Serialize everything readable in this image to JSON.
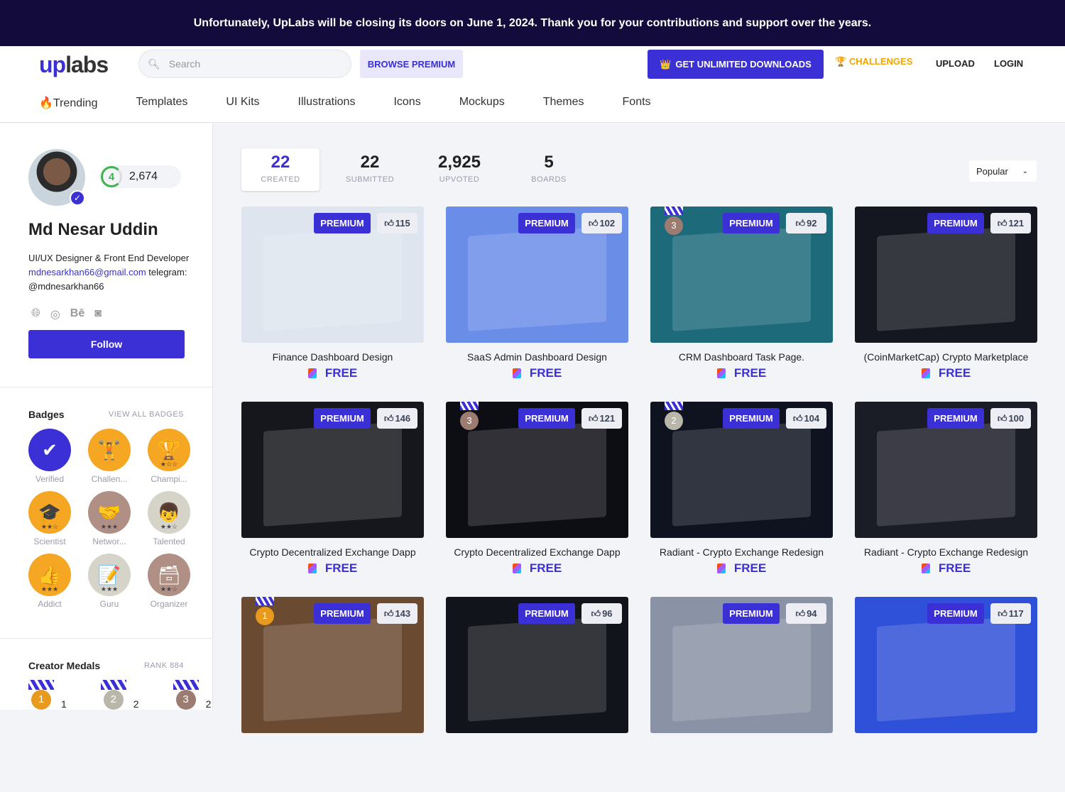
{
  "banner": "Unfortunately, UpLabs will be closing its doors on June 1, 2024. Thank you for your contributions and support over the years.",
  "header": {
    "logo_up": "up",
    "logo_labs": "labs",
    "search_placeholder": "Search",
    "browse_premium": "BROWSE PREMIUM",
    "get_unlimited": "GET UNLIMITED DOWNLOADS",
    "challenges": "CHALLENGES",
    "upload": "UPLOAD",
    "login": "LOGIN"
  },
  "nav": [
    "🔥Trending",
    "Templates",
    "UI Kits",
    "Illustrations",
    "Icons",
    "Mockups",
    "Themes",
    "Fonts"
  ],
  "profile": {
    "level": "4",
    "points": "2,674",
    "name": "Md Nesar Uddin",
    "role": "UI/UX Designer & Front End Developer",
    "email": "mdnesarkhan66@gmail.com",
    "telegram": " telegram: @mdnesarkhan66",
    "follow": "Follow"
  },
  "badges": {
    "title": "Badges",
    "view_all": "VIEW ALL BADGES",
    "items": [
      {
        "label": "Verified",
        "icon": "✔",
        "color": "#3b2fd6",
        "stars": ""
      },
      {
        "label": "Challen...",
        "icon": "🏋",
        "color": "#f5a623",
        "stars": ""
      },
      {
        "label": "Champi...",
        "icon": "🏆",
        "color": "#f5a623",
        "stars": "★☆☆"
      },
      {
        "label": "Scientist",
        "icon": "🎓",
        "color": "#f5a623",
        "stars": "★★☆"
      },
      {
        "label": "Networ...",
        "icon": "🤝",
        "color": "#b08f84",
        "stars": "★★★"
      },
      {
        "label": "Talented",
        "icon": "👦",
        "color": "#d6d3c8",
        "stars": "★★☆"
      },
      {
        "label": "Addict",
        "icon": "👍",
        "color": "#f5a623",
        "stars": "★★★"
      },
      {
        "label": "Guru",
        "icon": "📝",
        "color": "#d6d3c8",
        "stars": "★★★"
      },
      {
        "label": "Organizer",
        "icon": "🗃",
        "color": "#b08f84",
        "stars": "★★☆"
      }
    ]
  },
  "medals": {
    "title": "Creator Medals",
    "rank": "RANK 884",
    "items": [
      {
        "place": "1",
        "count": "1",
        "color": "#e89a1f"
      },
      {
        "place": "2",
        "count": "2",
        "color": "#b9b6aa"
      },
      {
        "place": "3",
        "count": "2",
        "color": "#9c7b70"
      }
    ]
  },
  "stats": [
    {
      "value": "22",
      "label": "CREATED"
    },
    {
      "value": "22",
      "label": "SUBMITTED"
    },
    {
      "value": "2,925",
      "label": "UPVOTED"
    },
    {
      "value": "5",
      "label": "BOARDS"
    }
  ],
  "sort": "Popular",
  "cards": [
    {
      "title": "Finance Dashboard Design",
      "likes": "115",
      "price": "FREE",
      "badge": "PREMIUM",
      "bg": "#dfe5ef",
      "medal": ""
    },
    {
      "title": "SaaS Admin Dashboard Design",
      "likes": "102",
      "price": "FREE",
      "badge": "PREMIUM",
      "bg": "#6a8de8",
      "medal": ""
    },
    {
      "title": "CRM Dashboard Task Page.",
      "likes": "92",
      "price": "FREE",
      "badge": "PREMIUM",
      "bg": "#1d6a7a",
      "medal": "3"
    },
    {
      "title": "(CoinMarketCap) Crypto Marketplace",
      "likes": "121",
      "price": "FREE",
      "badge": "PREMIUM",
      "bg": "#14171f",
      "medal": ""
    },
    {
      "title": "Crypto Decentralized Exchange Dapp",
      "likes": "146",
      "price": "FREE",
      "badge": "PREMIUM",
      "bg": "#16171c",
      "medal": ""
    },
    {
      "title": "Crypto Decentralized Exchange Dapp",
      "likes": "121",
      "price": "FREE",
      "badge": "PREMIUM",
      "bg": "#0d0d14",
      "medal": "3"
    },
    {
      "title": "Radiant - Crypto Exchange Redesign",
      "likes": "104",
      "price": "FREE",
      "badge": "PREMIUM",
      "bg": "#0f1320",
      "medal": "2"
    },
    {
      "title": "Radiant - Crypto Exchange Redesign",
      "likes": "100",
      "price": "FREE",
      "badge": "PREMIUM",
      "bg": "#1a1c26",
      "medal": ""
    },
    {
      "title": "",
      "likes": "143",
      "price": "",
      "badge": "PREMIUM",
      "bg": "#6b4a32",
      "medal": "1"
    },
    {
      "title": "",
      "likes": "96",
      "price": "",
      "badge": "PREMIUM",
      "bg": "#12141c",
      "medal": ""
    },
    {
      "title": "",
      "likes": "94",
      "price": "",
      "badge": "PREMIUM",
      "bg": "#8a93a6",
      "medal": ""
    },
    {
      "title": "",
      "likes": "117",
      "price": "",
      "badge": "PREMIUM",
      "bg": "#2f50d8",
      "medal": ""
    }
  ]
}
